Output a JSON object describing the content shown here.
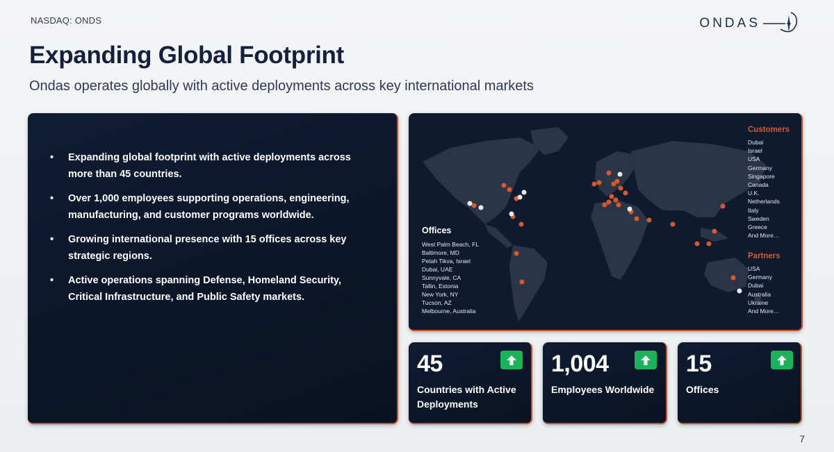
{
  "header": {
    "ticker": "NASDAQ: ONDS",
    "logo_text": "ONDAS"
  },
  "slide": {
    "title": "Expanding Global Footprint",
    "subtitle": "Ondas operates globally with active deployments across key international markets",
    "page_number": "7"
  },
  "bullets": [
    "Expanding global footprint with active deployments across more than 45 countries.",
    "Over 1,000 employees supporting operations, engineering, manufacturing, and customer programs worldwide.",
    "Growing international presence with 15 offices across key strategic regions.",
    "Active operations spanning Defense, Homeland Security, Critical Infrastructure, and Public Safety markets."
  ],
  "map": {
    "offices_title": "Offices",
    "offices": [
      "West Palm Beach, FL",
      "Baltimore, MD",
      "Petah Tikva, Israel",
      "Dubai, UAE",
      "Sunnyvale, CA",
      "Tallin, Estonia",
      "New York, NY",
      "Tucson, AZ",
      "Melbourne, Australia"
    ],
    "customers_title": "Customers",
    "customers": [
      "Dubai",
      "Israel",
      "USA",
      "Germany",
      "Singapore",
      "Canada",
      "U.K.",
      "Netherlands",
      "Italy",
      "Sweden",
      "Greece",
      "And More…"
    ],
    "partners_title": "Partners",
    "partners": [
      "USA",
      "Germany",
      "Dubai",
      "Australia",
      "Ukraine",
      "And More…"
    ]
  },
  "stats": [
    {
      "value": "45",
      "label": "Countries with Active Deployments"
    },
    {
      "value": "1,004",
      "label": "Employees Worldwide"
    },
    {
      "value": "15",
      "label": "Offices"
    }
  ],
  "colors": {
    "accent": "#c2532a",
    "panel": "#0e1c33",
    "badge": "#19b35a",
    "title": "#13213f",
    "pin_orange": "#d9582c",
    "pin_white": "#e8ebf0"
  }
}
